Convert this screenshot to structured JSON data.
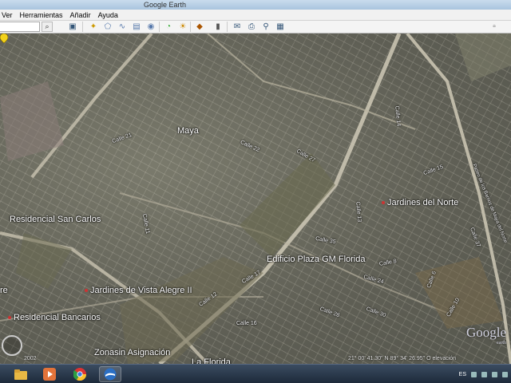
{
  "window": {
    "title": "Google Earth"
  },
  "menu": [
    "Ver",
    "Herramientas",
    "Añadir",
    "Ayuda"
  ],
  "map": {
    "places": [
      {
        "id": "maya",
        "label": "Maya"
      },
      {
        "id": "residencial-san-carlos",
        "label": "Residencial San Carlos"
      },
      {
        "id": "jardines-del-norte",
        "label": "Jardines del Norte"
      },
      {
        "id": "edificio-plaza-gm-florida",
        "label": "Edificio Plaza GM Florida"
      },
      {
        "id": "jardines-de-vista-alegre",
        "label": "Jardines de Vista Alegre II"
      },
      {
        "id": "residencial-bancarios",
        "label": "Residencial Bancarios"
      },
      {
        "id": "zonasin-asignacion",
        "label": "Zonasin Asignación"
      },
      {
        "id": "la-florida",
        "label": "La Florida"
      },
      {
        "id": "prefix-re",
        "label": "re"
      }
    ],
    "streets": [
      "Calle 21",
      "Calle 22",
      "Calle 27",
      "Calle 15",
      "Calle 35",
      "Calle 8",
      "Calle 12",
      "Calle 17",
      "Calle 28",
      "Calle 24",
      "Calle 16",
      "Calle 11",
      "Calle 13",
      "Calle 14",
      "Calle 30",
      "Calle 10",
      "Calle 6",
      "Calle 37",
      "Paseo de los Barrios de Maya del Norte"
    ]
  },
  "status": {
    "year": "2002",
    "coords": "21° 00' 41.30\" N   89° 34' 26.95\" O  elevación"
  },
  "logo": {
    "text": "Google",
    "sub": "earth"
  },
  "taskbar": {
    "lang": "ES"
  }
}
